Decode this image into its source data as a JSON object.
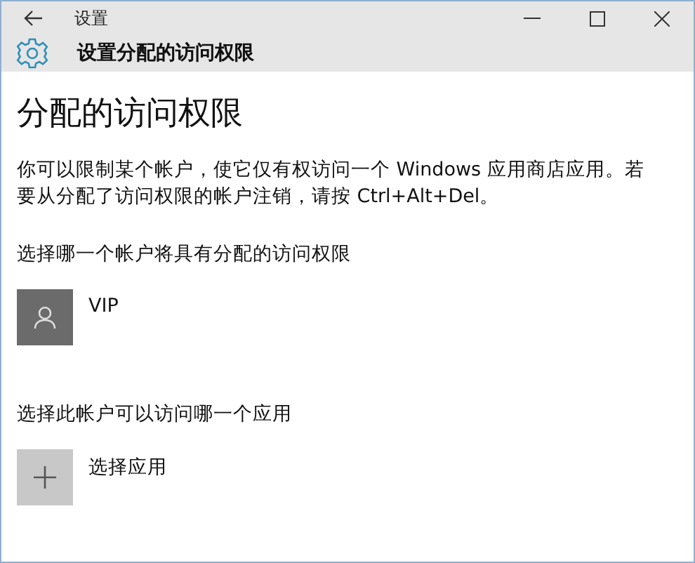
{
  "window": {
    "title": "设置"
  },
  "header": {
    "title": "设置分配的访问权限"
  },
  "page": {
    "heading": "分配的访问权限",
    "description": "你可以限制某个帐户，使它仅有权访问一个 Windows 应用商店应用。若要从分配了访问权限的帐户注销，请按 Ctrl+Alt+Del。"
  },
  "sections": [
    {
      "label": "选择哪一个帐户将具有分配的访问权限",
      "item": {
        "kind": "account",
        "name": "VIP"
      }
    },
    {
      "label": "选择此帐户可以访问哪一个应用",
      "item": {
        "kind": "add",
        "name": "选择应用"
      }
    }
  ]
}
